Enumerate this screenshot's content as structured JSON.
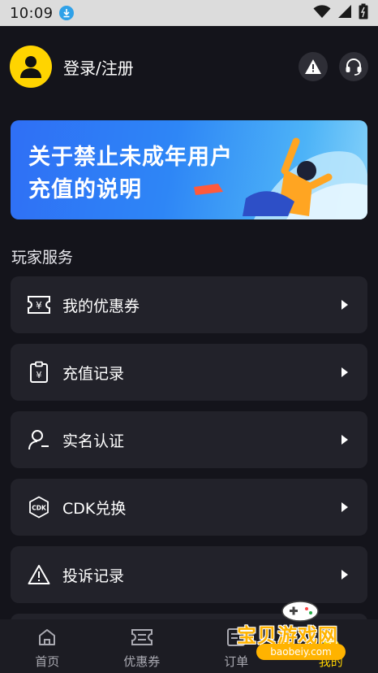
{
  "status_bar": {
    "time": "10:09"
  },
  "header": {
    "login_label": "登录/注册"
  },
  "banner": {
    "line1": "关于禁止未成年用户",
    "line2": "充值的说明"
  },
  "section_title": "玩家服务",
  "menu": [
    {
      "label": "我的优惠券",
      "icon": "coupon-icon"
    },
    {
      "label": "充值记录",
      "icon": "recharge-record-icon"
    },
    {
      "label": "实名认证",
      "icon": "user-verify-icon"
    },
    {
      "label": "CDK兑换",
      "icon": "cdk-icon"
    },
    {
      "label": "投诉记录",
      "icon": "warning-icon"
    }
  ],
  "tabs": [
    {
      "label": "首页",
      "icon": "home-icon"
    },
    {
      "label": "优惠券",
      "icon": "coupon-icon"
    },
    {
      "label": "订单",
      "icon": "order-icon"
    },
    {
      "label": "我的",
      "icon": "profile-icon"
    }
  ],
  "watermark": {
    "title": "宝贝游戏网",
    "url": "baobeiy.com"
  },
  "colors": {
    "accent": "#ffd400",
    "background": "#14141b",
    "card": "#22222a",
    "banner": "#2e86f6"
  }
}
